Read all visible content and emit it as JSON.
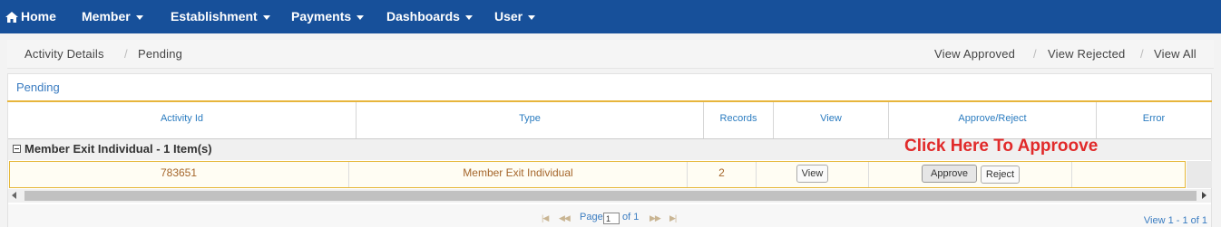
{
  "navbar": {
    "home": "Home",
    "items": [
      "Member",
      "Establishment",
      "Payments",
      "Dashboards",
      "User"
    ]
  },
  "breadcrumb": {
    "items": [
      "Activity Details",
      "Pending"
    ],
    "separator": "/"
  },
  "view_links": [
    "View Approved",
    "View Rejected",
    "View All"
  ],
  "panel": {
    "title": "Pending"
  },
  "grid": {
    "columns": [
      "Activity Id",
      "Type",
      "Records",
      "View",
      "Approve/Reject",
      "Error"
    ],
    "group": {
      "label": "Member Exit Individual - 1 Item(s)"
    },
    "row": {
      "activity_id": "783651",
      "type": "Member Exit Individual",
      "records": "2",
      "view_label": "View",
      "approve_label": "Approve",
      "reject_label": "Reject",
      "error": ""
    }
  },
  "annotation": "Click Here To Approove",
  "pager": {
    "page_label": "Page",
    "page_value": "1",
    "of_label": "of 1",
    "info": "View 1 - 1 of 1"
  },
  "colors": {
    "navbar": "#17509a",
    "link": "#3a7cc1",
    "accent_border": "#e5b737",
    "annotation": "#e12a2a",
    "cell_text": "#a5662b"
  }
}
